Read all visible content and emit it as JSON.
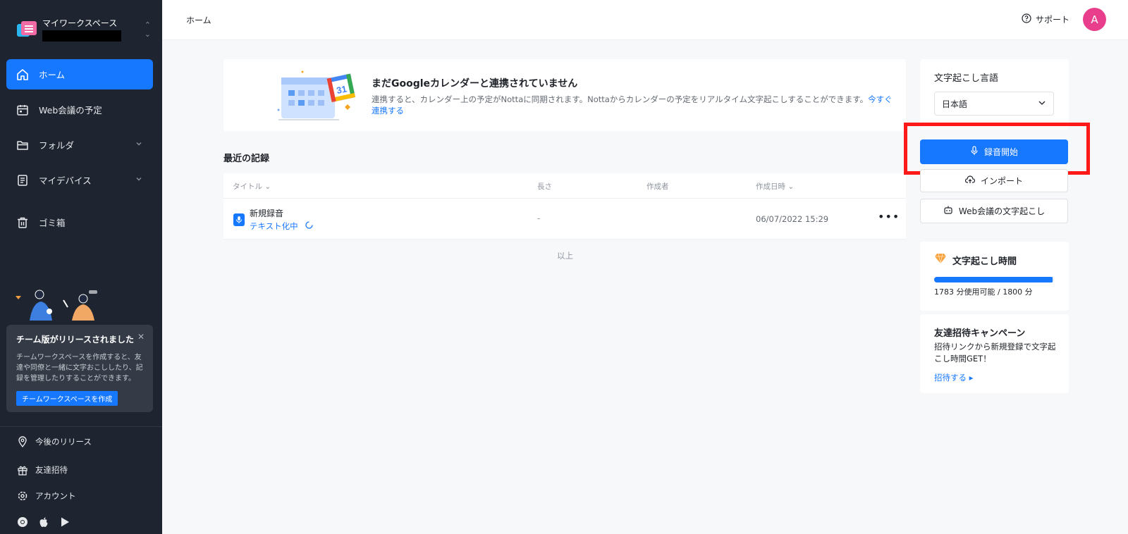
{
  "workspace": {
    "name": "マイワークスペース"
  },
  "sidebar": {
    "items": [
      {
        "label": "ホーム"
      },
      {
        "label": "Web会議の予定"
      },
      {
        "label": "フォルダ"
      },
      {
        "label": "マイデバイス"
      },
      {
        "label": "ゴミ箱"
      }
    ],
    "promo": {
      "title": "チーム版がリリースされました",
      "description": "チームワークスペースを作成すると、友達や同僚と一緒に文字おこししたり、記録を管理したりすることができます。",
      "button": "チームワークスペースを作成"
    },
    "bottom": [
      {
        "label": "今後のリリース"
      },
      {
        "label": "友達招待"
      },
      {
        "label": "アカウント"
      }
    ]
  },
  "topbar": {
    "breadcrumb": "ホーム",
    "support": "サポート",
    "avatar": "A"
  },
  "banner": {
    "title": "まだGoogleカレンダーと連携されていません",
    "description": "連携すると、カレンダー上の予定がNottaに同期されます。Nottaからカレンダーの予定をリアルタイム文字起こしすることができます。",
    "link": "今すぐ連携する",
    "calendar_day": "31"
  },
  "recent": {
    "title": "最近の記録",
    "columns": [
      "タイトル",
      "長さ",
      "作成者",
      "作成日時"
    ],
    "rows": [
      {
        "title": "新規録音",
        "status": "テキスト化中",
        "length": "-",
        "author": "",
        "date": "06/07/2022 15:29"
      }
    ],
    "end": "以上"
  },
  "right": {
    "language_title": "文字起こし言語",
    "language_value": "日本語",
    "record_button": "録音開始",
    "import_button": "インポート",
    "meeting_button": "Web会議の文字起こし",
    "time_title": "文字起こし時間",
    "time_text": "1783 分使用可能 / 1800 分",
    "time_used_fraction": 0.99,
    "invite_title": "友達招待キャンペーン",
    "invite_desc": "招待リンクから新規登録で文字起こし時間GET！",
    "invite_link": "招待する"
  },
  "colors": {
    "accent": "#1677ff",
    "sidebar": "#1f2530",
    "highlight": "#ff1a1a",
    "avatar": "#e83e8c"
  }
}
